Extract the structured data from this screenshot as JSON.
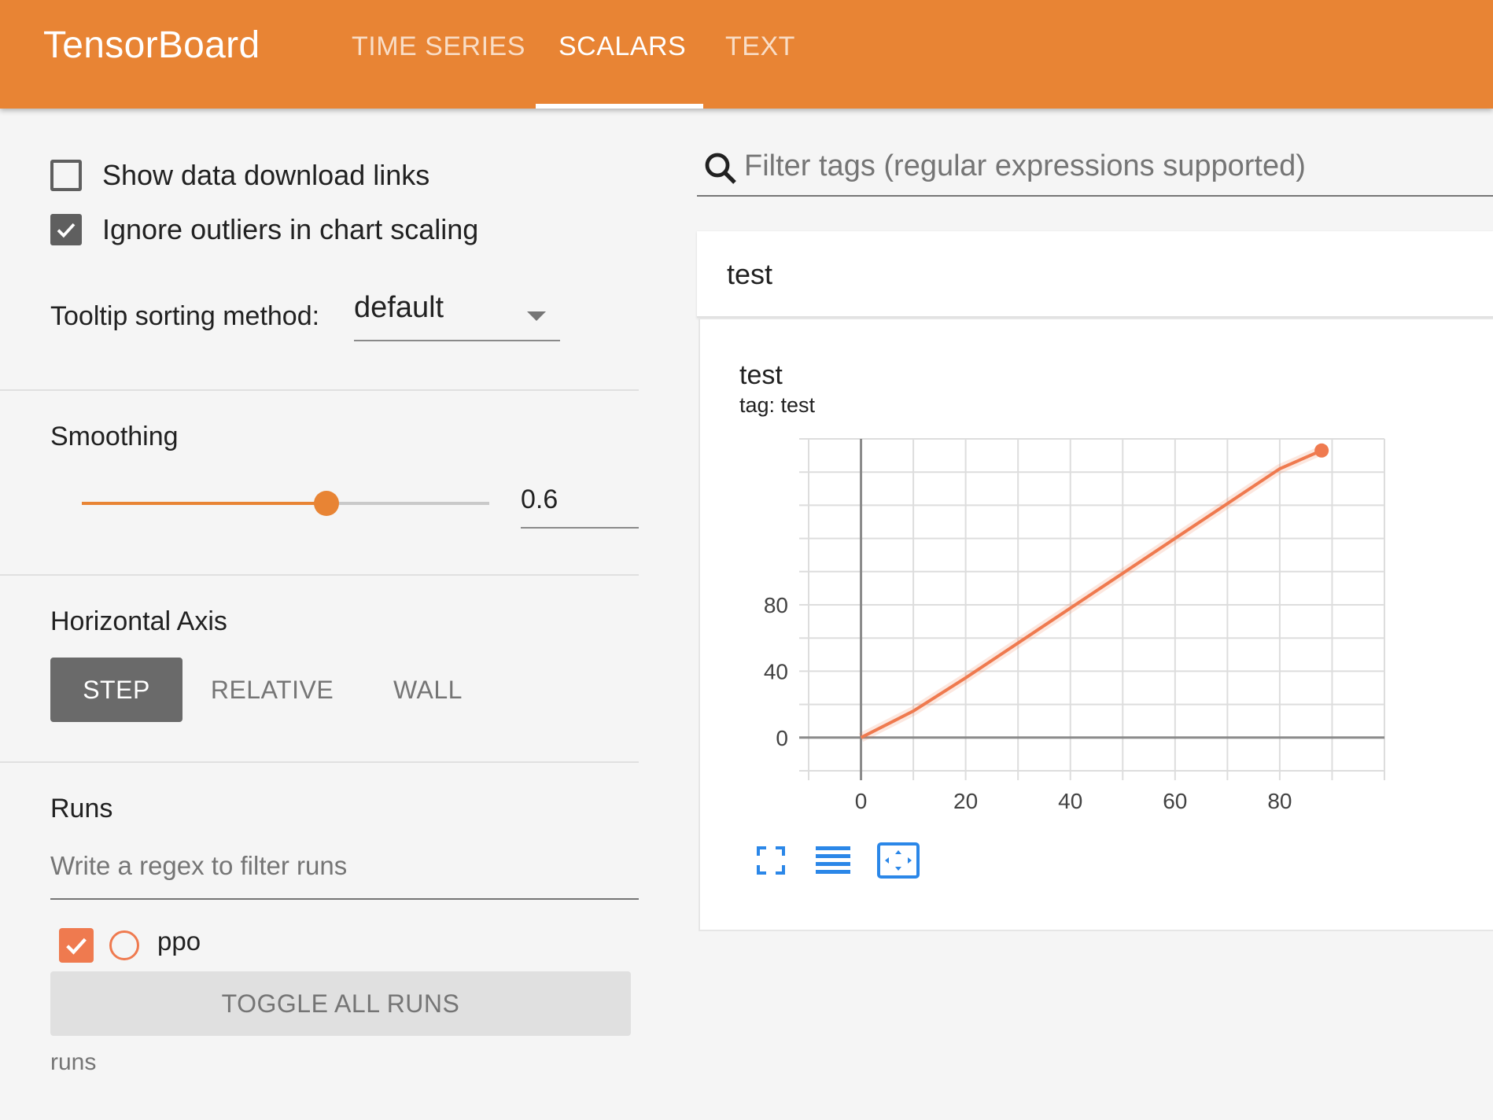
{
  "header": {
    "brand": "TensorBoard",
    "tabs": [
      {
        "label": "TIME SERIES",
        "active": false
      },
      {
        "label": "SCALARS",
        "active": true
      },
      {
        "label": "TEXT",
        "active": false
      }
    ],
    "color": "#e88434"
  },
  "sidebar": {
    "show_download_links": {
      "label": "Show data download links",
      "checked": false
    },
    "ignore_outliers": {
      "label": "Ignore outliers in chart scaling",
      "checked": true
    },
    "tooltip_sorting": {
      "label": "Tooltip sorting method:",
      "value": "default"
    },
    "smoothing": {
      "title": "Smoothing",
      "value": "0.6",
      "fraction": 0.6
    },
    "horizontal_axis": {
      "title": "Horizontal Axis",
      "options": [
        "STEP",
        "RELATIVE",
        "WALL"
      ],
      "selected": "STEP"
    },
    "runs": {
      "title": "Runs",
      "filter_placeholder": "Write a regex to filter runs",
      "items": [
        {
          "name": "ppo",
          "checked": true,
          "color": "#ef7a4f"
        }
      ],
      "toggle_label": "TOGGLE ALL RUNS",
      "footer": "runs"
    }
  },
  "main": {
    "search_placeholder": "Filter tags (regular expressions supported)",
    "card": {
      "header_title": "test",
      "chart_title": "test",
      "chart_subtitle": "tag: test"
    },
    "chart_buttons": [
      "fullscreen-icon",
      "toggle-y-log-icon",
      "fit-domain-icon"
    ]
  },
  "chart_data": {
    "type": "line",
    "title": "test",
    "subtitle": "tag: test",
    "xlabel": "",
    "ylabel": "",
    "xlim": [
      -10,
      100
    ],
    "ylim": [
      -20,
      180
    ],
    "x_ticks": [
      0,
      20,
      40,
      60,
      80
    ],
    "y_ticks": [
      0,
      40,
      80
    ],
    "grid": true,
    "series": [
      {
        "name": "ppo",
        "color": "#ef7a4f",
        "x": [
          0,
          10,
          20,
          30,
          40,
          50,
          60,
          70,
          80,
          88
        ],
        "values": [
          0,
          16,
          36,
          57,
          78,
          99,
          120,
          141,
          162,
          173
        ]
      }
    ]
  }
}
